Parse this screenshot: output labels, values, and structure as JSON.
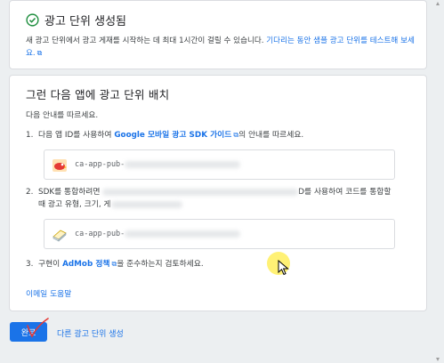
{
  "card1": {
    "title": "광고 단위 생성됨",
    "desc_part1": "새 광고 단위에서 광고 게재를 시작하는 데 최대 1시간이 걸릴 수 있습니다. ",
    "desc_link": "기다리는 동안 샘플 광고 단위를 테스트해 보세요."
  },
  "card2": {
    "title": "그런 다음 앱에 광고 단위 배치",
    "follow": "다음 안내를 따르세요.",
    "step1": {
      "num": "1.",
      "text_a": "다음 앱 ID를 사용하여 ",
      "link": "Google 모바일 광고 SDK 가이드",
      "text_b": "의 안내를 따르세요.",
      "app_id_prefix": "ca-app-pub-"
    },
    "step2": {
      "num": "2.",
      "line1_a": "SDK를 통합하려면 ",
      "line1_b": "D를 사용하여 코드를 통합할",
      "line2": "때 광고 유형, 크기, 게",
      "unit_id_prefix": "ca-app-pub-"
    },
    "step3": {
      "num": "3.",
      "text_a": "구현이 ",
      "link": "AdMob 정책",
      "text_b": "을 준수하는지 검토하세요."
    },
    "email_link": "이메일 도움말"
  },
  "footer": {
    "done_label": "완료",
    "another_label": "다른 광고 단위 생성"
  },
  "colors": {
    "accent": "#1a73e8",
    "success": "#1e8e3e",
    "page_bg": "#eceff1"
  }
}
